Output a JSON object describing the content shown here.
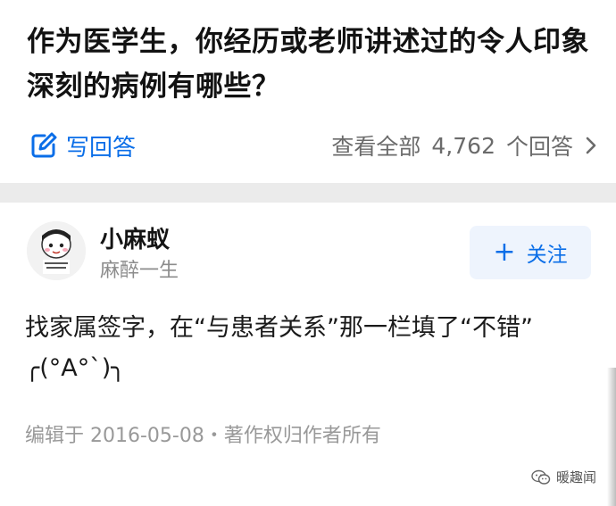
{
  "question": {
    "title": "作为医学生，你经历或老师讲述过的令人印象深刻的病例有哪些？"
  },
  "actions": {
    "write_answer_label": "写回答",
    "view_all_prefix": "查看全部",
    "answer_count": "4,762",
    "view_all_suffix": "个回答",
    "icons": {
      "write": "edit-icon",
      "chevron": "chevron-right-icon"
    }
  },
  "answer": {
    "author": {
      "name": "小麻蚁",
      "bio": "麻醉一生",
      "avatar_icon": "avatar-image"
    },
    "follow_label": "关注",
    "follow_plus": "+",
    "text_line1": "找家属签字，在“与患者关系”那一栏填了“不错”",
    "text_line2": "╭(°A°`)╮",
    "meta": "编辑于 2016-05-08・著作权归作者所有"
  },
  "watermark": {
    "label": "暖趣闻",
    "icon": "wechat-icon"
  },
  "colors": {
    "accent": "#0a6ee8",
    "muted": "#999999",
    "divider": "#ebebeb"
  }
}
